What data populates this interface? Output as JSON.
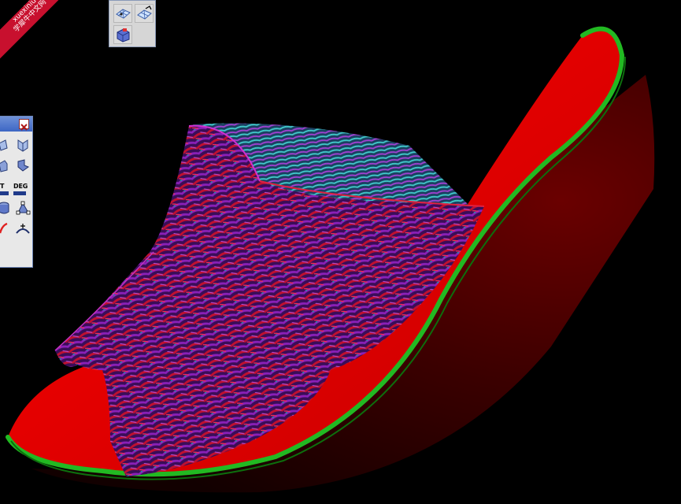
{
  "watermark": {
    "line1": "xuexiniu",
    "line2": "学犀牛中文网"
  },
  "colors": {
    "background": "#000000",
    "sole": "#e00000",
    "heel": "#5a0000",
    "rim": "#22b922",
    "strap_purple": "#7a1a9a",
    "strap_cyan": "#30d0d0"
  },
  "toolbar_top": {
    "buttons": [
      {
        "icon": "mesh-grid-icon"
      },
      {
        "icon": "mesh-edit-icon"
      },
      {
        "icon": "mesh-shade-icon"
      }
    ]
  },
  "left_panel": {
    "buttons": [
      {
        "icon": "surface-fold-icon"
      },
      {
        "icon": "surface-bend-icon"
      },
      {
        "icon": "box-shade-icon"
      },
      {
        "icon": "surface-twist-icon"
      },
      {
        "icon": "cylinder-icon"
      },
      {
        "icon": "triangle-points-icon"
      },
      {
        "icon": "red-curve-icon"
      },
      {
        "icon": "arc-point-icon"
      }
    ],
    "labels": {
      "t_label": "T",
      "deg_label": "DEG"
    }
  }
}
